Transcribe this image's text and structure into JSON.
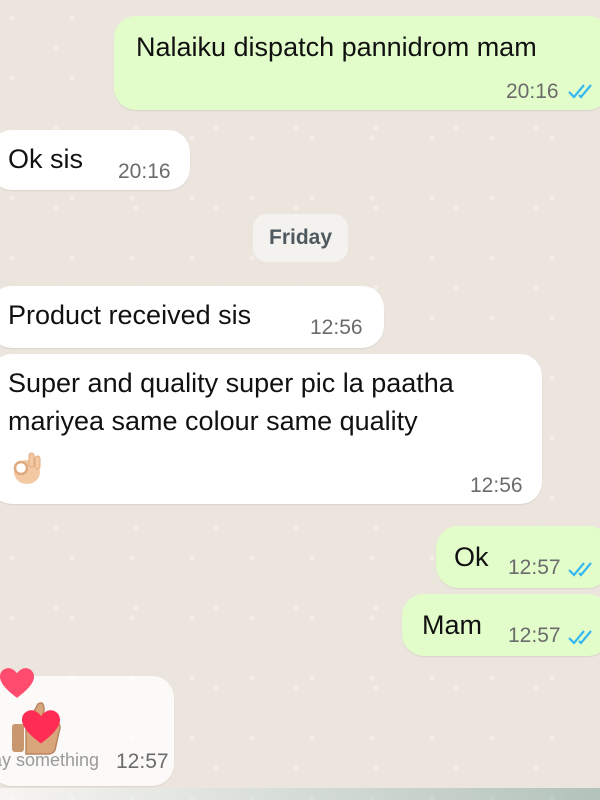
{
  "messages": [
    {
      "direction": "out",
      "text": "Nalaiku dispatch pannidrom mam",
      "time": "20:16",
      "status": "read"
    },
    {
      "direction": "in",
      "text": "Ok sis",
      "time": "20:16"
    },
    {
      "direction": "in",
      "text": "Product received sis",
      "time": "12:56"
    },
    {
      "direction": "in",
      "text": "Super and quality super pic la paatha\nmariyea same colour same quality",
      "time": "12:56",
      "emoji": "ok-hand-emoji"
    },
    {
      "direction": "out",
      "text": "Ok",
      "time": "12:57",
      "status": "read"
    },
    {
      "direction": "out",
      "text": "Mam",
      "time": "12:57",
      "status": "read"
    },
    {
      "direction": "in",
      "text": "",
      "time": "12:57",
      "emoji": "thumbs-up-emoji"
    }
  ],
  "date_divider": "Friday",
  "live_overlay": {
    "comment_placeholder": "ay something",
    "reaction_icon": "heart-icon"
  },
  "colors": {
    "background": "#ece5dd",
    "outgoing_bubble": "#e2fdca",
    "incoming_bubble": "#ffffff",
    "read_ticks": "#34b7f1",
    "heart": "#ff4b6e"
  }
}
